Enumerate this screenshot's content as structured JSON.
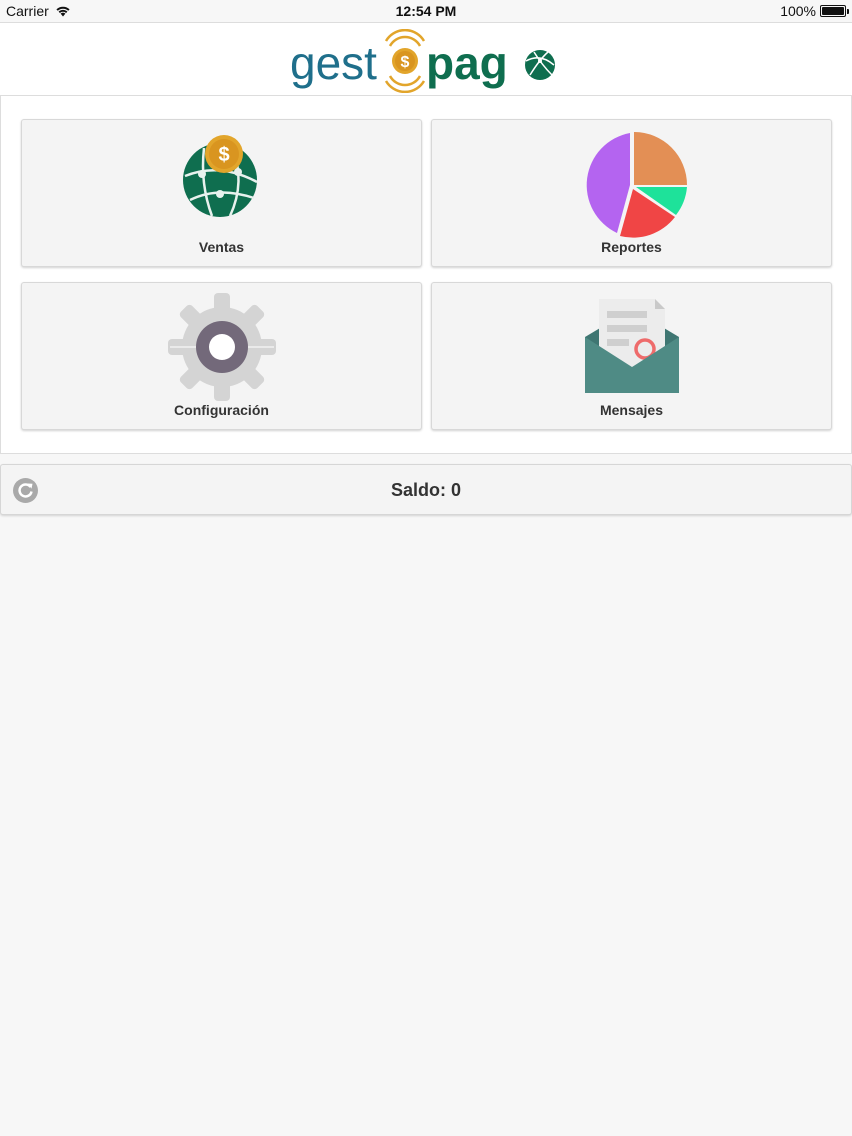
{
  "status_bar": {
    "carrier": "Carrier",
    "time": "12:54 PM",
    "battery": "100%",
    "battery_level": 1.0
  },
  "header": {
    "logo_text_left": "gest",
    "logo_text_right": "pag",
    "logo_symbol": "$",
    "colors": {
      "teal": "#1f6f8b",
      "green": "#0f6e4f",
      "gold": "#e2a52b"
    }
  },
  "menu": {
    "tiles": [
      {
        "label": "Ventas",
        "icon": "globe-coin-icon"
      },
      {
        "label": "Reportes",
        "icon": "pie-chart-icon"
      },
      {
        "label": "Configuración",
        "icon": "gear-icon"
      },
      {
        "label": "Mensajes",
        "icon": "envelope-icon"
      }
    ]
  },
  "footer": {
    "saldo_text": "Saldo: 0",
    "refresh_icon": "refresh-icon"
  }
}
